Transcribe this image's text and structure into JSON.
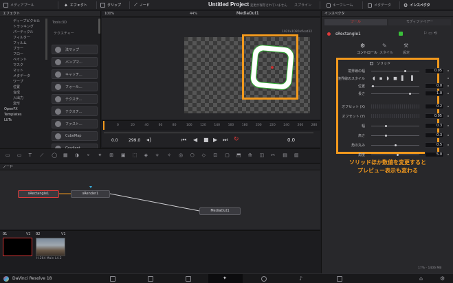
{
  "topbar": {
    "media_pool": "メディアプール",
    "effects": "エフェクト",
    "clips": "クリップ",
    "nodes": "ノード",
    "project_title": "Untitled Project",
    "save_status": "変更が保存されていません",
    "spline": "スプライン",
    "keyframes": "キーフレーム",
    "metadata": "メタデータ",
    "inspector": "インスペクタ"
  },
  "effects_panel": {
    "header": "エフェクト",
    "items": [
      "ディープピクセル",
      "トラッキング",
      "パーティクル",
      "フィルター",
      "フィルム",
      "ブラー",
      "フロー",
      "ペイント",
      "マスク",
      "マット",
      "メタデータ",
      "ワープ",
      "位置",
      "合成",
      "入出力",
      "変形",
      "OpenFX",
      "Templates",
      "LUTs"
    ],
    "tools_header": "Tools:3D",
    "texture_header": "テクスチャー",
    "tools": [
      "法マップ",
      "バンプマ...",
      "キャッチ...",
      "フォール...",
      "テクスチ...",
      "テクスチ...",
      "ファスト...",
      "CubeMap",
      "Gradient"
    ]
  },
  "viewer": {
    "zoom_left": "100%",
    "zoom_right": "44%",
    "viewer_name": "MediaOut1",
    "resolution": "1920x1080xfloat32",
    "time_start": "0.0",
    "time_end": "299.0",
    "timecode": "0.0",
    "ruler_ticks": [
      "0",
      "20",
      "40",
      "60",
      "80",
      "100",
      "120",
      "140",
      "160",
      "180",
      "200",
      "220",
      "240",
      "260",
      "280"
    ]
  },
  "nodes_panel": {
    "header": "ノード",
    "nodes": [
      "sRectangle1",
      "sRender1",
      "MediaOut1"
    ]
  },
  "clips": {
    "clip1_num": "01",
    "clip1_track": "V2",
    "clip2_num": "02",
    "clip2_track": "V1",
    "clip2_codec": "H.264 Main L4.2"
  },
  "inspector": {
    "header": "インスペクタ",
    "tab_tools": "ツール",
    "tab_modifiers": "モディファイアー",
    "node_name": "sRectangle1",
    "subtab_controls": "コントロール",
    "subtab_style": "スタイル",
    "subtab_settings": "設定",
    "solid_label": "ソリッド",
    "rows1": [
      {
        "label": "境界線の幅",
        "value": "0.05",
        "pos": 0.72
      },
      {
        "label": "境界線のスタイル",
        "value": "",
        "pos": null
      },
      {
        "label": "位置",
        "value": "0.0",
        "pos": 0.02
      },
      {
        "label": "長さ",
        "value": "1.0",
        "pos": 0.82
      }
    ],
    "rows2": [
      {
        "label": "オフセット (X)",
        "value": "0.2",
        "pos": null
      },
      {
        "label": "オフセット (Y)",
        "value": "0.05",
        "pos": null
      },
      {
        "label": "幅",
        "value": "0.3",
        "pos": 0.3
      },
      {
        "label": "高さ",
        "value": "0.3",
        "pos": 0.3
      },
      {
        "label": "角の丸み",
        "value": "0.5",
        "pos": 0.5
      },
      {
        "label": "角度",
        "value": "5.0",
        "pos": 0.55
      }
    ],
    "memory": "17% - 1406 MB"
  },
  "annotation": {
    "line1": "ソリッドほか数値を変更すると",
    "line2": "プレビュー表示も変わる",
    "color": "#f2991d"
  },
  "taskbar": {
    "app_name": "DaVinci Resolve 18"
  }
}
